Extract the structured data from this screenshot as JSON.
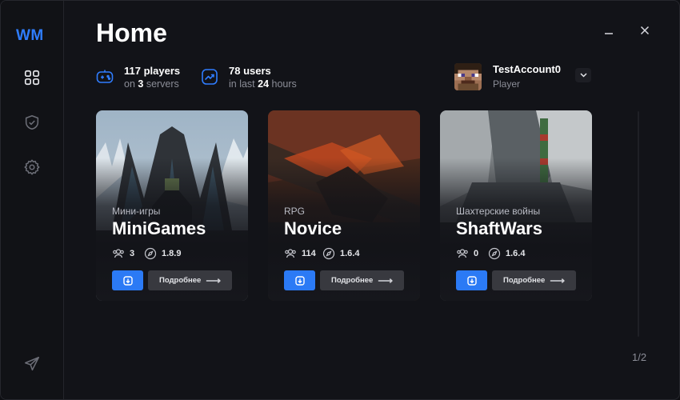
{
  "app": {
    "logo": "WM",
    "page_title": "Home"
  },
  "colors": {
    "accent": "#2b7af5",
    "background": "#121318",
    "muted": "#8b8d97"
  },
  "sidebar": {
    "items": [
      {
        "icon": "grid-icon",
        "active": true
      },
      {
        "icon": "shield-check-icon",
        "active": false
      },
      {
        "icon": "gear-icon",
        "active": false
      },
      {
        "icon": "paper-plane-icon",
        "active": false
      }
    ]
  },
  "stats": {
    "players": {
      "count_label": "117 players",
      "sub_prefix": "on ",
      "sub_value": "3",
      "sub_suffix": " servers",
      "icon": "gamepad-icon"
    },
    "users": {
      "count_label": "78 users",
      "sub_prefix": "in last ",
      "sub_value": "24",
      "sub_suffix": " hours",
      "icon": "trend-chart-icon"
    }
  },
  "account": {
    "name": "TestAccount0",
    "role": "Player"
  },
  "servers": [
    {
      "category": "Мини-игры",
      "name": "MiniGames",
      "players": "3",
      "version": "1.8.9",
      "more_label": "Подробнее"
    },
    {
      "category": "RPG",
      "name": "Novice",
      "players": "114",
      "version": "1.6.4",
      "more_label": "Подробнее"
    },
    {
      "category": "Шахтерские войны",
      "name": "ShaftWars",
      "players": "0",
      "version": "1.6.4",
      "more_label": "Подробнее"
    }
  ],
  "pagination": {
    "label": "1/2"
  }
}
